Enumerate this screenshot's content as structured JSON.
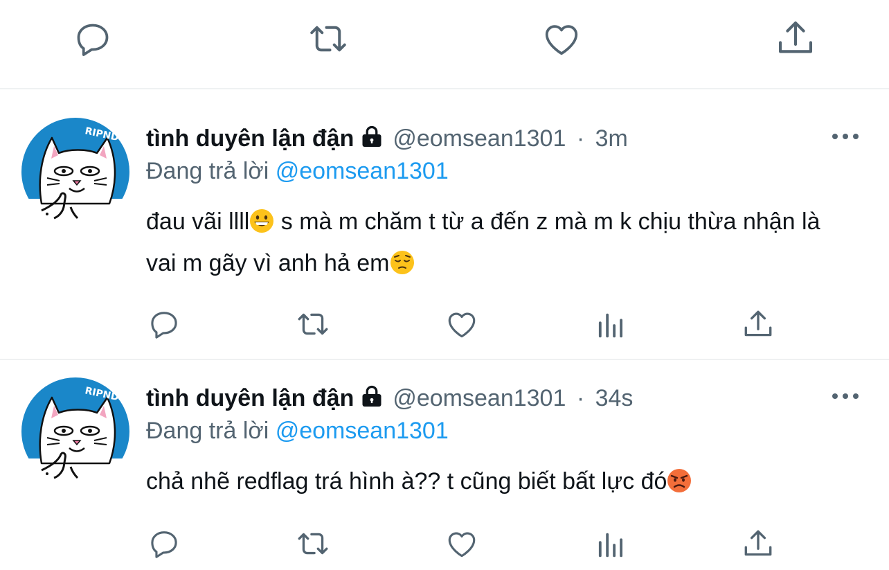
{
  "top_actions": {
    "icons": [
      "reply-icon",
      "retweet-icon",
      "like-icon",
      "share-icon"
    ]
  },
  "tweets": [
    {
      "display_name": "tình duyên lận đận",
      "handle": "@eomsean1301",
      "separator": "·",
      "time": "3m",
      "reply_prefix": "Đang trả lời",
      "reply_to": "@eomsean1301",
      "text_a": "đau vãi llll",
      "emoji_a": "grinning-face",
      "text_b": " s mà m chăm t từ a đến z mà m k chịu thừa nhận là vai m gãy vì anh hả em",
      "emoji_b": "pensive-face",
      "actions": [
        "reply-icon",
        "retweet-icon",
        "like-icon",
        "analytics-icon",
        "share-icon"
      ]
    },
    {
      "display_name": "tình duyên lận đận",
      "handle": "@eomsean1301",
      "separator": "·",
      "time": "34s",
      "reply_prefix": "Đang trả lời",
      "reply_to": "@eomsean1301",
      "text_a": "chả nhẽ redflag trá hình à?? t cũng biết bất lực đó",
      "emoji_a": "angry-face",
      "actions": [
        "reply-icon",
        "retweet-icon",
        "like-icon",
        "analytics-icon",
        "share-icon"
      ]
    }
  ],
  "colors": {
    "icon_gray": "#536471",
    "link_blue": "#1d9bf0",
    "avatar_blue": "#1a87c9",
    "divider": "#eff1f2"
  }
}
